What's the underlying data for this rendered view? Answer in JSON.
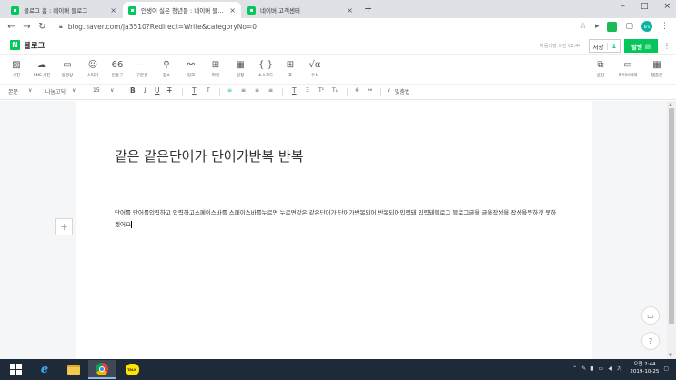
{
  "browser": {
    "tabs": [
      {
        "title": "블로그 홈 : 네이버 블로그",
        "active": false
      },
      {
        "title": "인생이 실은 청년들 : 네이버 블로그",
        "active": true
      },
      {
        "title": "네이버 고객센터",
        "active": false
      }
    ],
    "close_glyph": "×",
    "new_tab": "+",
    "window_controls": [
      "–",
      "□",
      "×"
    ],
    "url_scheme_icon": "lock-icon",
    "url": "blog.naver.com/ja3510?Redirect=Write&categoryNo=0",
    "profile_initial": "bro"
  },
  "blog_header": {
    "logo": "N",
    "title": "블로그",
    "autosave": "자동저장 오전 02:44",
    "save_label": "저장",
    "save_count": "1",
    "publish_label": "발행",
    "publish_icon": "▤"
  },
  "insert_toolbar": [
    {
      "icon": "image-icon",
      "glyph": "▨",
      "label": "사진"
    },
    {
      "icon": "cloud-icon",
      "glyph": "☁",
      "label": "SNS 사진"
    },
    {
      "icon": "video-icon",
      "glyph": "▭",
      "label": "동영상"
    },
    {
      "icon": "sticker-icon",
      "glyph": "☺",
      "label": "스티커"
    },
    {
      "icon": "quote-icon",
      "glyph": "66",
      "label": "인용구"
    },
    {
      "icon": "divider-icon",
      "glyph": "—",
      "label": "구분선"
    },
    {
      "icon": "place-icon",
      "glyph": "⚲",
      "label": "장소"
    },
    {
      "icon": "link-icon",
      "glyph": "⚯",
      "label": "링크"
    },
    {
      "icon": "file-icon",
      "glyph": "⊞",
      "label": "파일"
    },
    {
      "icon": "schedule-icon",
      "glyph": "▦",
      "label": "일정"
    },
    {
      "icon": "code-icon",
      "glyph": "{ }",
      "label": "소스코드"
    },
    {
      "icon": "table-icon",
      "glyph": "⊞",
      "label": "표"
    },
    {
      "icon": "formula-icon",
      "glyph": "√α",
      "label": "수식"
    }
  ],
  "right_tools": [
    {
      "icon": "library-icon",
      "glyph": "⧉",
      "label": "글감"
    },
    {
      "icon": "template-icon",
      "glyph": "▭",
      "label": "라이브러리"
    },
    {
      "icon": "layout-icon",
      "glyph": "▦",
      "label": "템플릿"
    }
  ],
  "format_toolbar": {
    "style": "본문",
    "font": "나눔고딕",
    "size": "15",
    "bold": "B",
    "italic": "I",
    "underline": "U",
    "strike": "T",
    "text_color": "T",
    "bg_color": "T",
    "align_left": "≡",
    "align_center": "≡",
    "align_right": "≡",
    "align_justify": "≡",
    "line_height": "T",
    "letter_spacing": "Ξ",
    "superscript": "T¹",
    "subscript": "T₁",
    "special_char": "※",
    "link": "⚯",
    "spellcheck": "맞춤법",
    "dropdown": "∨"
  },
  "document": {
    "title": "같은 같은단어가 단어가반복 반복",
    "body": "단어를 단어를입력하고 입력하고스페이스바를 스페이스바를누르면 누르면같은 같은단어가 단어가반복되어 반복되어입력돼 입력돼블로그 블로그글을 글을작성을 작성을못하겠 못하겠어요"
  },
  "side_buttons": {
    "plus": "+",
    "chat": "▭",
    "help": "?"
  },
  "taskbar": {
    "talk_label": "TALK",
    "tray_chevron": "⌃",
    "clock_time": "오전 2:44",
    "clock_date": "2019-10-25"
  }
}
